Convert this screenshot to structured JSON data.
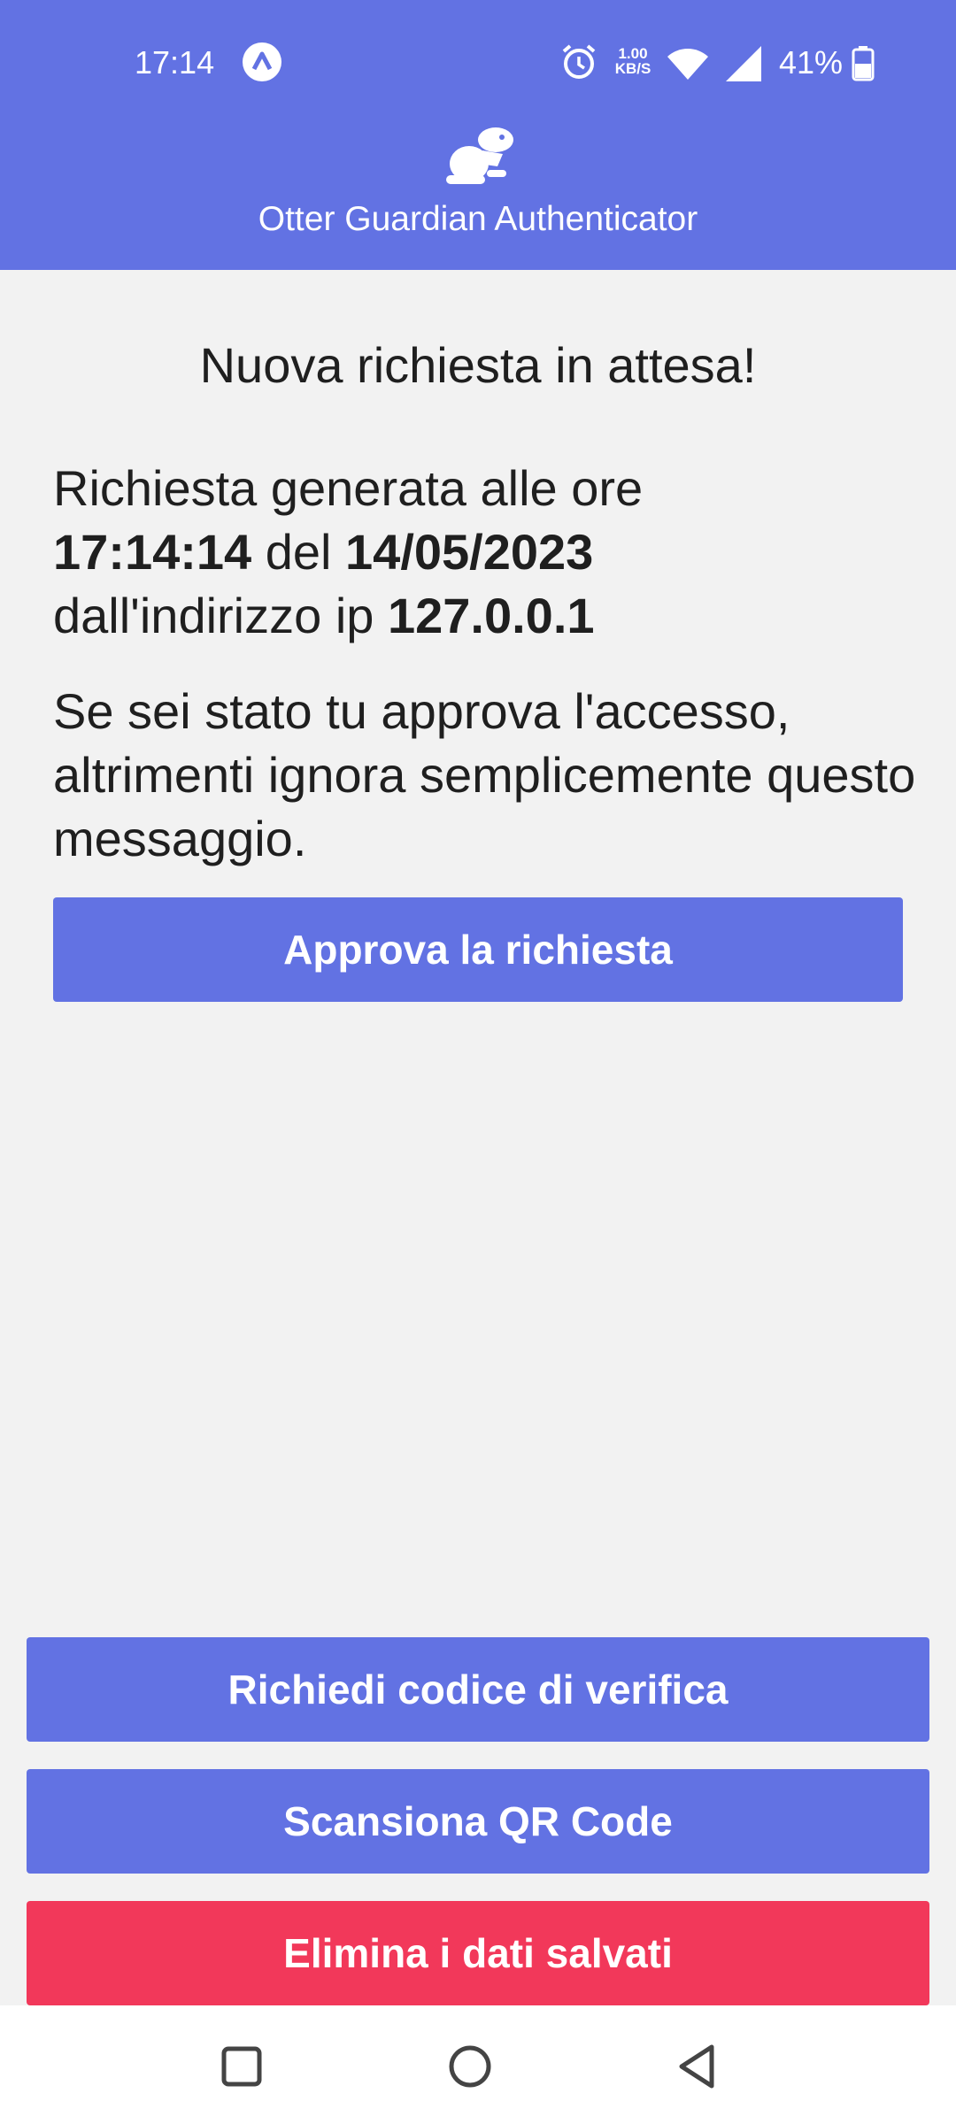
{
  "status_bar": {
    "time": "17:14",
    "network_speed_value": "1.00",
    "network_speed_unit": "KB/S",
    "battery_percent": "41%"
  },
  "header": {
    "app_title": "Otter Guardian Authenticator"
  },
  "request": {
    "heading": "Nuova richiesta in attesa!",
    "line1": "Richiesta generata alle ore",
    "time_value": "17:14:14",
    "date_sep": " del ",
    "date_value": "14/05/2023",
    "ip_prefix": "dall'indirizzo ip ",
    "ip_value": "127.0.0.1",
    "message": "Se sei stato tu approva l'accesso, altrimenti ignora semplicemente questo messaggio.",
    "approve_label": "Approva la richiesta"
  },
  "actions": {
    "request_code_label": "Richiedi codice di verifica",
    "scan_qr_label": "Scansiona QR Code",
    "delete_data_label": "Elimina i dati salvati"
  },
  "colors": {
    "primary": "#6272e3",
    "danger": "#f2385a",
    "background": "#f2f2f2"
  },
  "icons": {
    "status_app": "a-icon",
    "alarm": "alarm-icon",
    "wifi": "wifi-icon",
    "signal": "signal-icon",
    "battery": "battery-icon",
    "logo": "otter-logo-icon",
    "nav_recent": "square-icon",
    "nav_home": "circle-icon",
    "nav_back": "triangle-back-icon"
  }
}
